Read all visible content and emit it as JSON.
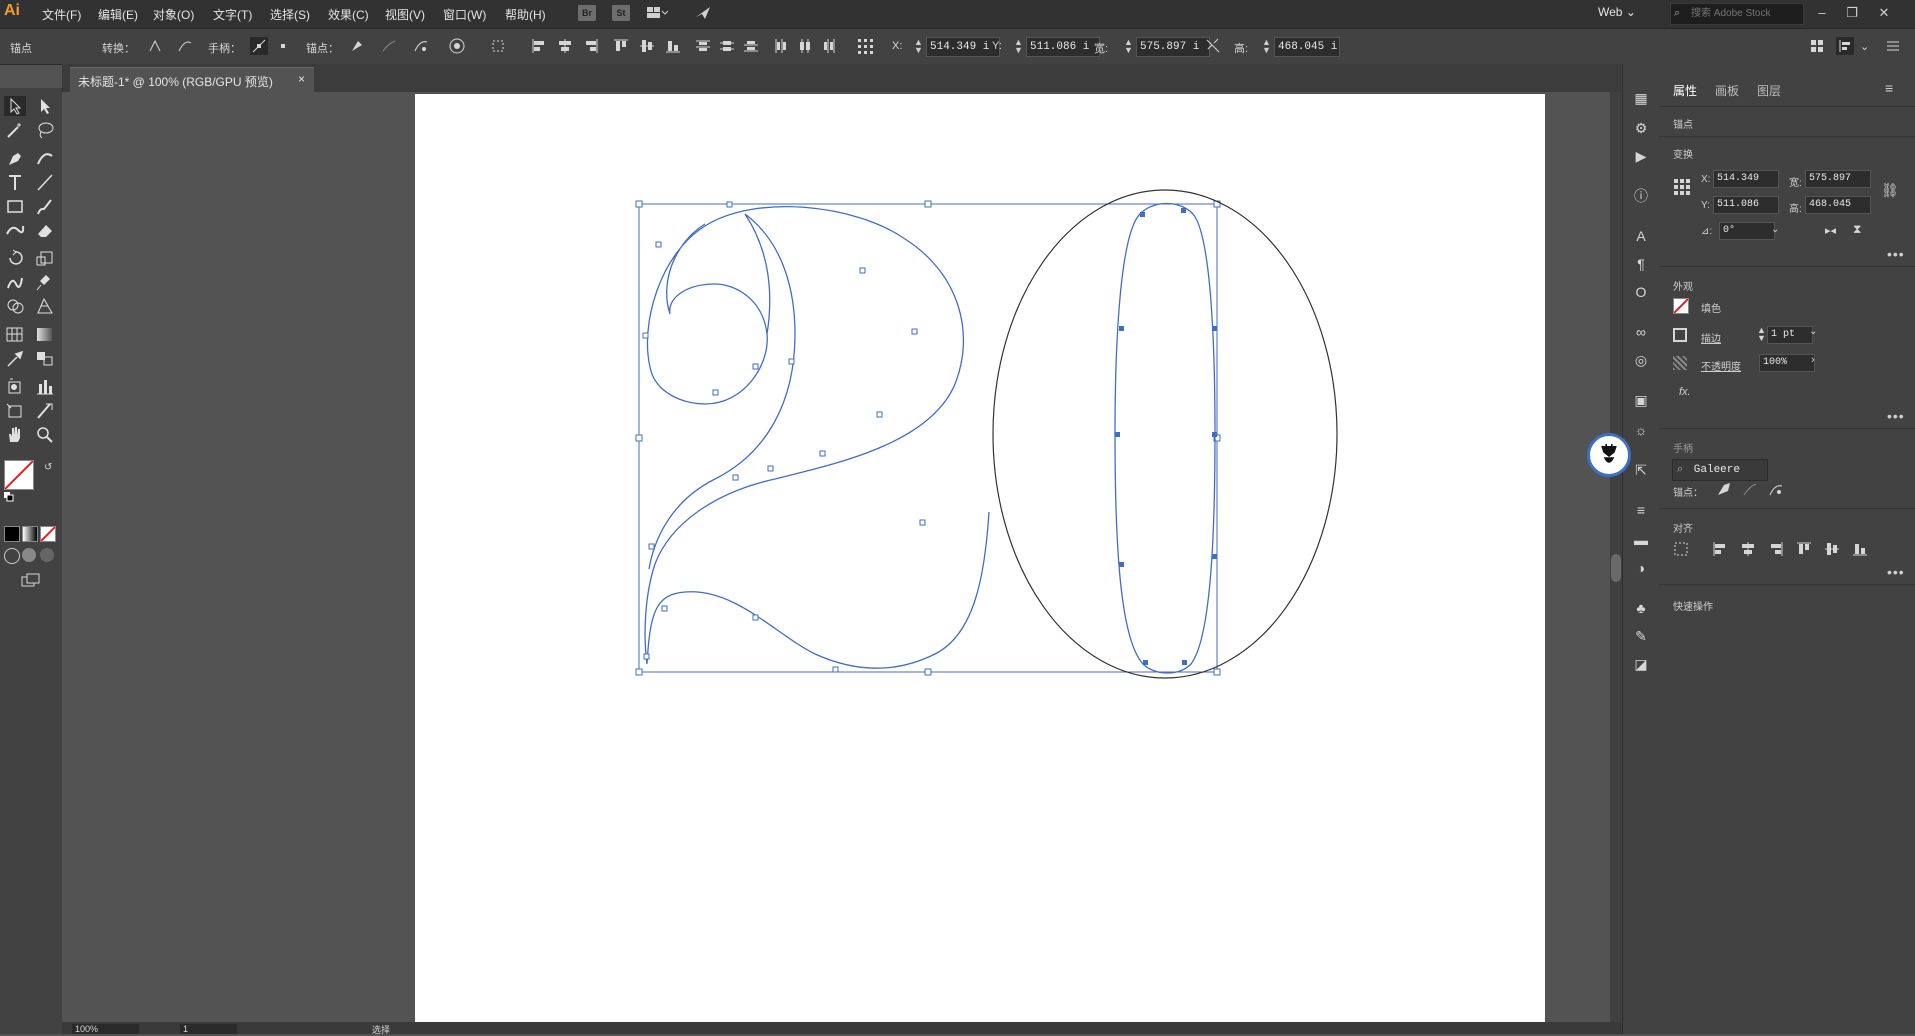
{
  "app": {
    "logo": "Ai"
  },
  "menu": [
    "文件(F)",
    "编辑(E)",
    "对象(O)",
    "文字(T)",
    "选择(S)",
    "效果(C)",
    "视图(V)",
    "窗口(W)",
    "帮助(H)"
  ],
  "menubar_buttons": [
    "Br",
    "St"
  ],
  "workspace": "Web",
  "stock_search": {
    "placeholder": "搜索 Adobe Stock"
  },
  "control": {
    "mode": "锚点",
    "convert": "转换：",
    "handles": "手柄：",
    "anchors": "锚点：",
    "x_label": "X:",
    "x": "514.349 i",
    "y_label": "Y:",
    "y": "511.086 i",
    "w_label": "宽:",
    "w": "575.897 i",
    "h_label": "高:",
    "h": "468.045 i"
  },
  "document": {
    "tab": "未标题-1* @ 100% (RGB/GPU 预览)",
    "close": "×"
  },
  "status": {
    "zoom": "100%",
    "page": "1",
    "tool": "选择"
  },
  "panel": {
    "tabs": [
      "属性",
      "画板",
      "图层"
    ],
    "section_anchor": "锚点",
    "transform": {
      "title": "变换",
      "x_label": "X:",
      "x": "514.349",
      "y_label": "Y:",
      "y": "511.086",
      "w_label": "宽:",
      "w": "575.897",
      "h_label": "高:",
      "h": "468.045",
      "angle_label": "⊿:",
      "angle": "0°"
    },
    "appearance": {
      "title": "外观",
      "fill": "填色",
      "stroke": "描边",
      "stroke_weight": "1 pt",
      "opacity_label": "不透明度",
      "opacity": "100%",
      "fx": "fx."
    },
    "handle": {
      "title": "手柄",
      "anchor_label": "锚点：",
      "search_value": "Galeere"
    },
    "align": {
      "title": "对齐"
    },
    "quick_actions": "快速操作",
    "more": "•••"
  },
  "colors": {
    "accent_path": "#3f6ec7",
    "watermark_border": "#3f6ec7",
    "logo": "#f29c2f"
  }
}
